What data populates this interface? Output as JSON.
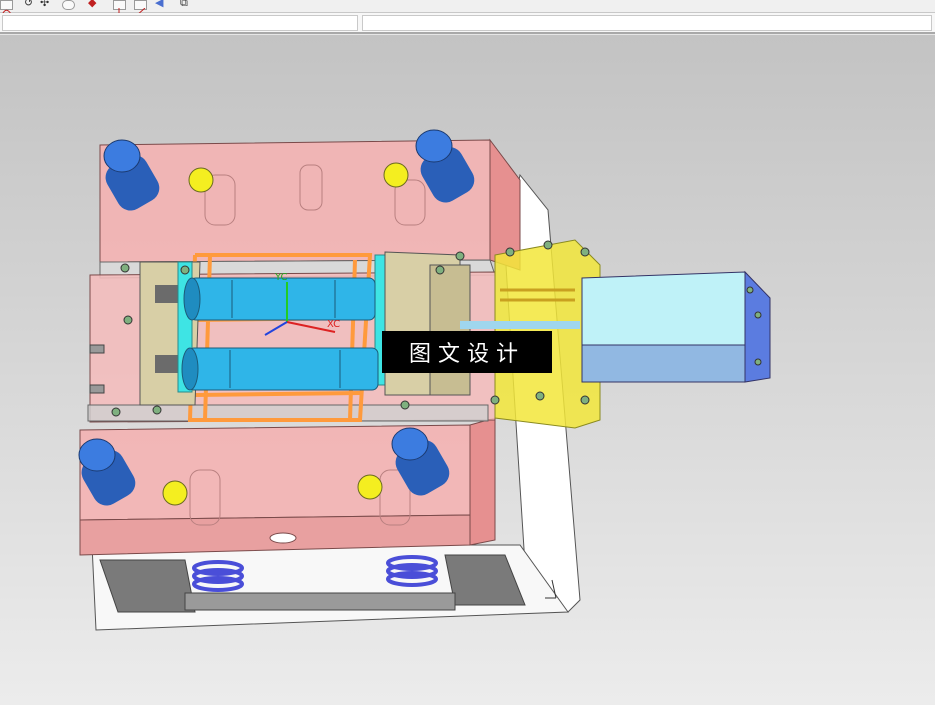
{
  "toolbar": {
    "buttons": [
      {
        "icon": "curve-icon"
      },
      {
        "icon": "undo-arc-icon"
      },
      {
        "icon": "arrow-cross-icon"
      },
      {
        "icon": "rotate-view-icon"
      },
      {
        "icon": "snap-point-icon"
      },
      {
        "icon": "point-vertical-icon"
      },
      {
        "icon": "snap-angle-icon"
      },
      {
        "icon": "surface-shade-icon"
      },
      {
        "icon": "section-view-icon"
      }
    ]
  },
  "viewport": {
    "axis": {
      "y_label": "YC",
      "x_label": "XC"
    },
    "watermark": "图文设计",
    "colors": {
      "plate_pink": "#f0a8a8",
      "leader_pin_blue": "#3c7ce0",
      "cylinder_cyan": "#2fb5e8",
      "hydraulic_block": "#bff2f8",
      "yellow_mount": "#f2e63a",
      "ejector_orange": "#ff9a3c",
      "spring_blue": "#4a4ed8",
      "slide_tan": "#d8cfa6"
    }
  }
}
